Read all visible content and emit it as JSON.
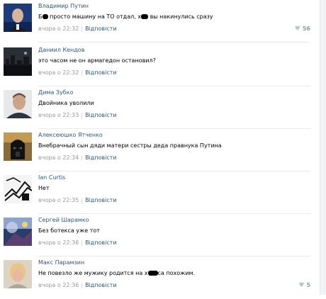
{
  "comments": [
    {
      "author": "Владимир Путин",
      "text_parts": [
        "Б",
        "redact:8",
        " просто машину на ТО отдал, х",
        "redact:10",
        " вы накинулись сразу"
      ],
      "time": "вчора о 22:32",
      "reply": "Відповісти",
      "likes": "56",
      "avatar": "putin"
    },
    {
      "author": "Даниил Кендов",
      "text_parts": [
        "это часом не он армагедон остановил?"
      ],
      "time": "вчора о 22:32",
      "reply": "Відповісти",
      "likes": "",
      "avatar": "city"
    },
    {
      "author": "Дима Зубко",
      "text_parts": [
        "Двойника уволили"
      ],
      "time": "вчора о 22:33",
      "reply": "Відповісти",
      "likes": "",
      "avatar": "profile"
    },
    {
      "author": "Алексеюшко Ятченко",
      "text_parts": [
        "Внебрачный сын дяди матери сестры деда правнука Путина"
      ],
      "time": "вчора о 22:34",
      "reply": "Відповісти",
      "likes": "",
      "avatar": "vader"
    },
    {
      "author": "Ian Curtis",
      "text_parts": [
        "Нет"
      ],
      "time": "вчора о 22:35",
      "reply": "Відповісти",
      "likes": "",
      "avatar": "lines"
    },
    {
      "author": "Сергей Шарамко",
      "text_parts": [
        "Без ботекса уже тот"
      ],
      "time": "вчора о 22:36",
      "reply": "Відповісти",
      "likes": "",
      "avatar": "abstract"
    },
    {
      "author": "Макс Парамзин",
      "text_parts": [
        "Не повезло же мужику родится на х",
        "redact:14",
        "са похожим."
      ],
      "time": "вчора о 22:36",
      "reply": "Відповісти",
      "likes": "5",
      "avatar": "blond"
    }
  ],
  "colors": {
    "author": "#2b587a",
    "meta": "#999999",
    "like": "#8a9cb0"
  },
  "icons": {
    "like": "heart-icon"
  }
}
